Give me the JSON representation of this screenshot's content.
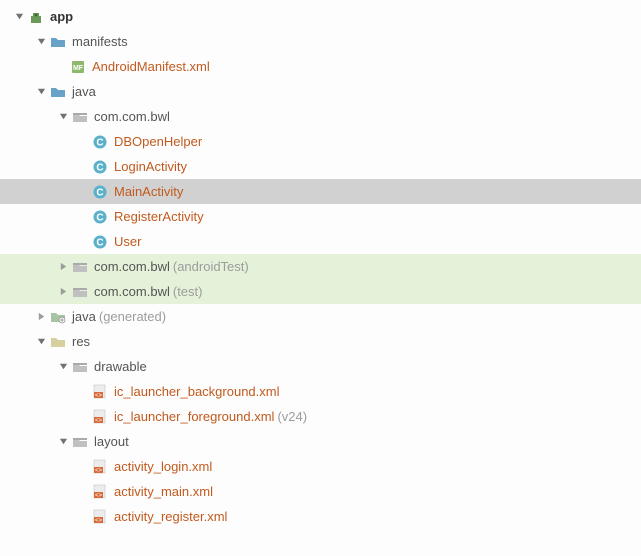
{
  "tree": {
    "app": "app",
    "manifests": "manifests",
    "android_manifest": "AndroidManifest.xml",
    "java": "java",
    "pkg": "com.com.bwl",
    "db_open_helper": "DBOpenHelper",
    "login_activity": "LoginActivity",
    "main_activity": "MainActivity",
    "register_activity": "RegisterActivity",
    "user": "User",
    "pkg_at": "com.com.bwl",
    "pkg_at_suffix": "(androidTest)",
    "pkg_test": "com.com.bwl",
    "pkg_test_suffix": "(test)",
    "java_gen": "java",
    "java_gen_suffix": "(generated)",
    "res": "res",
    "drawable": "drawable",
    "ic_bg": "ic_launcher_background.xml",
    "ic_fg": "ic_launcher_foreground.xml",
    "ic_fg_suffix": "(v24)",
    "layout": "layout",
    "act_login": "activity_login.xml",
    "act_main": "activity_main.xml",
    "act_register": "activity_register.xml"
  }
}
